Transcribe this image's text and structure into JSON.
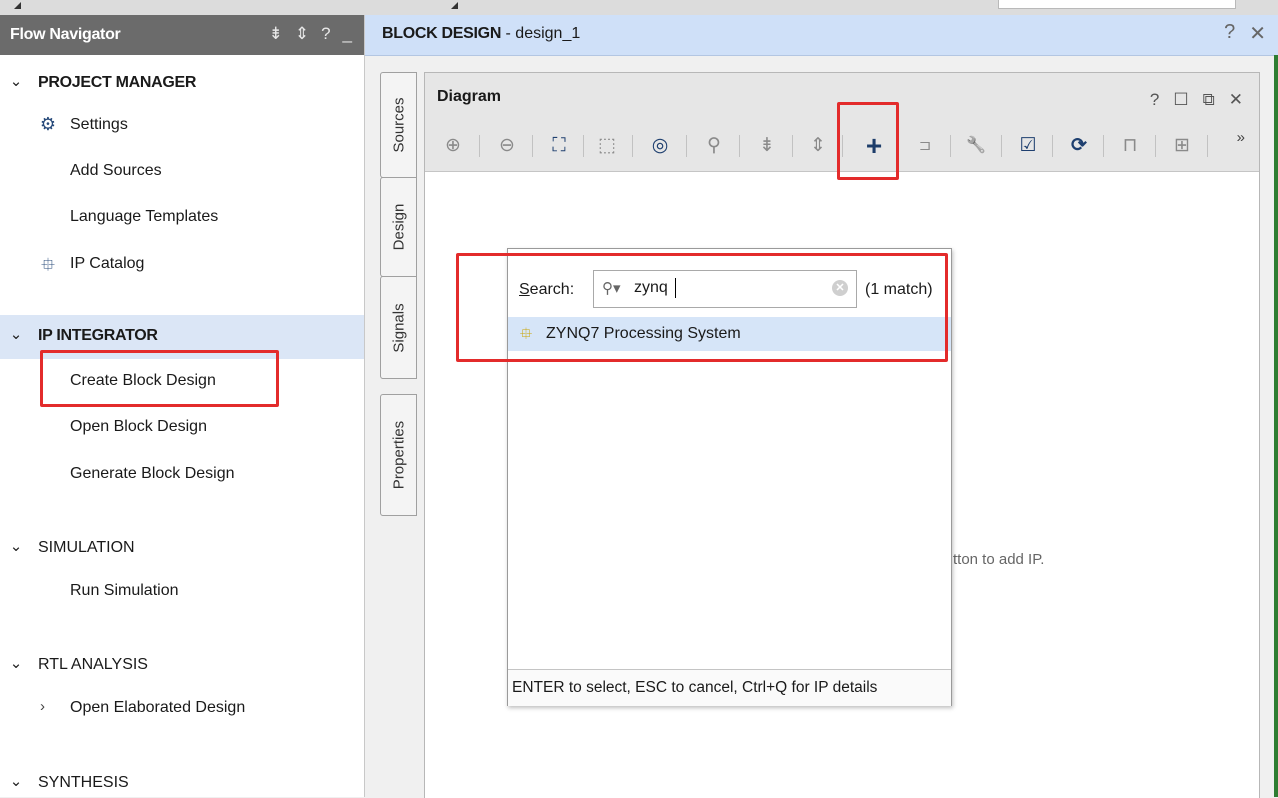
{
  "flow_navigator": {
    "title": "Flow Navigator",
    "header_icons": [
      "collapse-all-icon",
      "expand-all-icon",
      "help-icon",
      "minimize-icon"
    ],
    "header_glyphs": [
      "⇟",
      "⇕",
      "?",
      "_"
    ],
    "items": [
      {
        "kind": "section",
        "label": "PROJECT MANAGER",
        "expanded": true
      },
      {
        "kind": "sub",
        "label": "Settings",
        "icon": "gear-icon"
      },
      {
        "kind": "sub",
        "label": "Add Sources"
      },
      {
        "kind": "sub",
        "label": "Language Templates"
      },
      {
        "kind": "sub",
        "label": "IP Catalog",
        "icon": "ip-icon"
      },
      {
        "kind": "section",
        "label": "IP INTEGRATOR",
        "expanded": true,
        "selected": true
      },
      {
        "kind": "sub",
        "label": "Create Block Design",
        "highlighted": true
      },
      {
        "kind": "sub",
        "label": "Open Block Design"
      },
      {
        "kind": "sub",
        "label": "Generate Block Design"
      },
      {
        "kind": "section",
        "label": "SIMULATION",
        "expanded": true
      },
      {
        "kind": "sub",
        "label": "Run Simulation"
      },
      {
        "kind": "section",
        "label": "RTL ANALYSIS",
        "expanded": true
      },
      {
        "kind": "sub",
        "label": "Open Elaborated Design",
        "collapsed_child": true
      },
      {
        "kind": "section",
        "label": "SYNTHESIS",
        "expanded": true
      }
    ]
  },
  "block_design": {
    "title_bold": "BLOCK DESIGN",
    "title_rest": " - design_1",
    "header_glyphs": [
      "?",
      "✕"
    ]
  },
  "side_tabs": [
    "Sources",
    "Design",
    "Signals",
    "Properties"
  ],
  "diagram": {
    "title": "Diagram",
    "window_glyphs": [
      "?",
      "☐",
      "⧉",
      "✕"
    ],
    "toolbar": [
      {
        "name": "zoom-in-icon",
        "glyph": "⊕"
      },
      {
        "name": "zoom-out-icon",
        "glyph": "⊖"
      },
      {
        "name": "zoom-fit-icon",
        "glyph": "⛶"
      },
      {
        "name": "zoom-area-icon",
        "glyph": "⬚"
      },
      {
        "name": "autofit-selection-icon",
        "glyph": "◎"
      },
      {
        "name": "search-icon",
        "glyph": "⚲"
      },
      {
        "name": "collapse-all-icon",
        "glyph": "⇟"
      },
      {
        "name": "expand-all-icon",
        "glyph": "⇕"
      },
      {
        "name": "add-ip-icon",
        "glyph": "+"
      },
      {
        "name": "add-module-icon",
        "glyph": "⊐"
      },
      {
        "name": "properties-wrench-icon",
        "glyph": "🔧"
      },
      {
        "name": "validate-design-icon",
        "glyph": "☑"
      },
      {
        "name": "regenerate-layout-icon",
        "glyph": "⟳"
      },
      {
        "name": "optimize-routing-icon",
        "glyph": "⊓"
      },
      {
        "name": "ip-settings-icon",
        "glyph": "⊞"
      }
    ],
    "more_glyph": "»",
    "hint_text": "tton to add IP."
  },
  "popup": {
    "search_label_prefix": "S",
    "search_label_rest": "earch:",
    "search_value": "zynq",
    "match_count": "(1 match)",
    "result": "ZYNQ7 Processing System",
    "footer": "ENTER to select, ESC to cancel, Ctrl+Q for IP details"
  }
}
